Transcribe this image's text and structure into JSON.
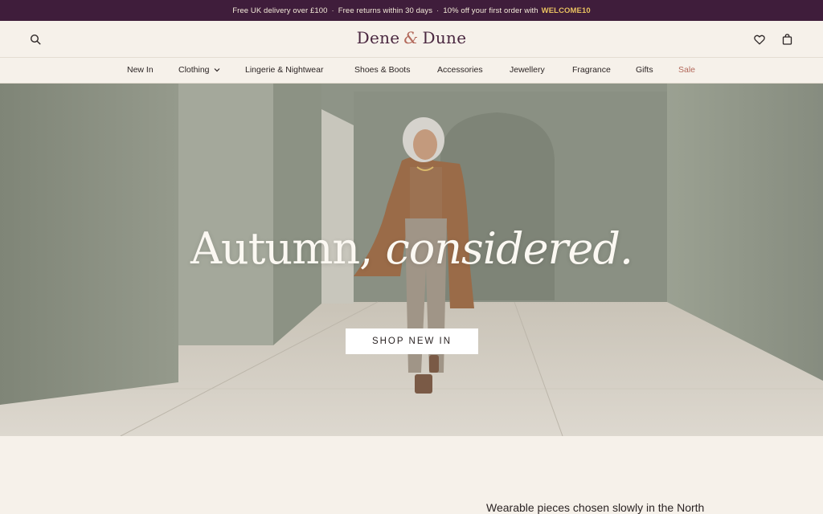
{
  "promo": {
    "delivery": "Free UK delivery over £100",
    "returns": "Free returns within 30 days",
    "offer": "10% off your first order with",
    "code": "WELCOME10",
    "separator": "·"
  },
  "header": {
    "logo_left": "Dene",
    "logo_amp": "&",
    "logo_right": "Dune",
    "icons": [
      "search-icon",
      "heart-icon",
      "bag-icon"
    ]
  },
  "nav": {
    "items": [
      {
        "label": "New In"
      },
      {
        "label": "Clothing",
        "icon": "chevron-down-icon"
      },
      {
        "label": "Lingerie & Nightwear"
      },
      {
        "label": "Shoes & Boots"
      },
      {
        "label": "Accessories"
      },
      {
        "label": "Jewellery"
      },
      {
        "label": "Fragrance"
      },
      {
        "label": "Gifts"
      },
      {
        "label": "Sale"
      }
    ]
  },
  "hero": {
    "headline_plain": "Autumn,",
    "headline_italic": "considered.",
    "cta_label": "SHOP NEW IN"
  },
  "intro": {
    "text": "Wearable pieces chosen slowly in the North"
  },
  "colors": {
    "promo_bg": "#3f1d3b",
    "promo_code": "#e8c160",
    "brand": "#4a2740",
    "accent": "#b3695b",
    "page_bg": "#f6f1ea"
  }
}
